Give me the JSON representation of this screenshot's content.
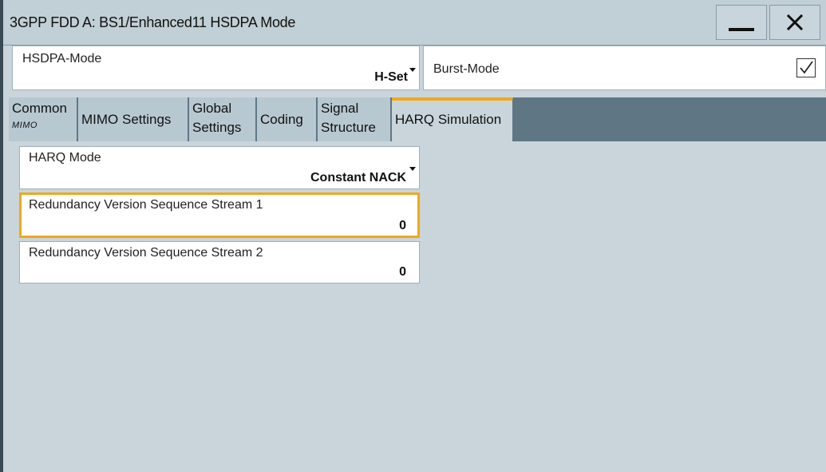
{
  "window": {
    "title": "3GPP FDD A: BS1/Enhanced11 HSDPA Mode"
  },
  "header": {
    "hsdpa_mode": {
      "label": "HSDPA-Mode",
      "value": "H-Set"
    },
    "burst_mode": {
      "label": "Burst-Mode",
      "checked": true
    }
  },
  "tabs": [
    {
      "line1": "Common",
      "sub": "MIMO"
    },
    {
      "line1": "MIMO Settings"
    },
    {
      "line1": "Global",
      "line2": "Settings"
    },
    {
      "line1": "Coding"
    },
    {
      "line1": "Signal",
      "line2": "Structure"
    },
    {
      "line1": "HARQ Simulation",
      "active": true
    }
  ],
  "harq": {
    "mode": {
      "label": "HARQ Mode",
      "value": "Constant NACK"
    },
    "rv_stream1": {
      "label": "Redundancy Version Sequence Stream 1",
      "value": "0"
    },
    "rv_stream2": {
      "label": "Redundancy Version Sequence Stream 2",
      "value": "0"
    }
  },
  "colors": {
    "accent": "#f0a81c",
    "tabstrip": "#5f7785",
    "background": "#c9d5db"
  }
}
